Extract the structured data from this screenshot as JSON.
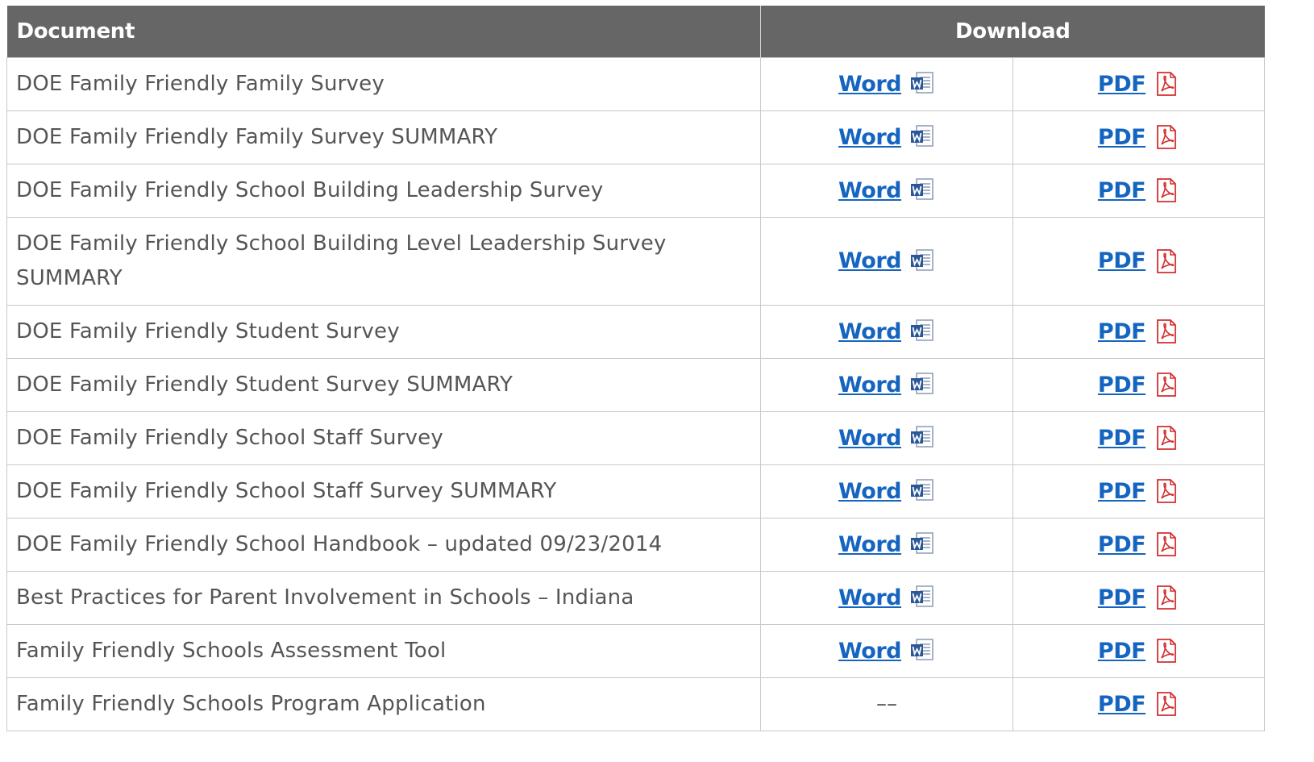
{
  "table": {
    "headers": {
      "document": "Document",
      "download": "Download"
    },
    "rows": [
      {
        "document": "DOE Family Friendly Family Survey",
        "word": "Word",
        "pdf": "PDF"
      },
      {
        "document": "DOE Family Friendly Family Survey SUMMARY",
        "word": "Word",
        "pdf": "PDF"
      },
      {
        "document": "DOE Family Friendly School Building Leadership Survey",
        "word": "Word",
        "pdf": "PDF"
      },
      {
        "document": "DOE Family Friendly School Building Level Leadership Survey SUMMARY",
        "word": "Word",
        "pdf": "PDF"
      },
      {
        "document": "DOE Family Friendly Student Survey",
        "word": "Word",
        "pdf": "PDF"
      },
      {
        "document": "DOE Family Friendly Student Survey SUMMARY",
        "word": "Word",
        "pdf": "PDF"
      },
      {
        "document": "DOE Family Friendly School Staff Survey",
        "word": "Word",
        "pdf": "PDF"
      },
      {
        "document": "DOE Family Friendly School Staff Survey SUMMARY",
        "word": "Word",
        "pdf": "PDF"
      },
      {
        "document": "DOE Family Friendly School Handbook – updated 09/23/2014",
        "word": "Word",
        "pdf": "PDF"
      },
      {
        "document": "Best Practices for Parent Involvement in Schools – Indiana",
        "word": "Word",
        "pdf": "PDF"
      },
      {
        "document": "Family Friendly Schools Assessment Tool",
        "word": "Word",
        "pdf": "PDF"
      },
      {
        "document": "Family Friendly Schools Program Application",
        "word": "––",
        "pdf": "PDF"
      }
    ]
  },
  "icons": {
    "word": "word-document-icon",
    "pdf": "pdf-document-icon"
  },
  "colors": {
    "header_bg": "#666666",
    "link": "#1565c0",
    "pdf_red": "#d32f2f",
    "border": "#c8c8c8"
  }
}
